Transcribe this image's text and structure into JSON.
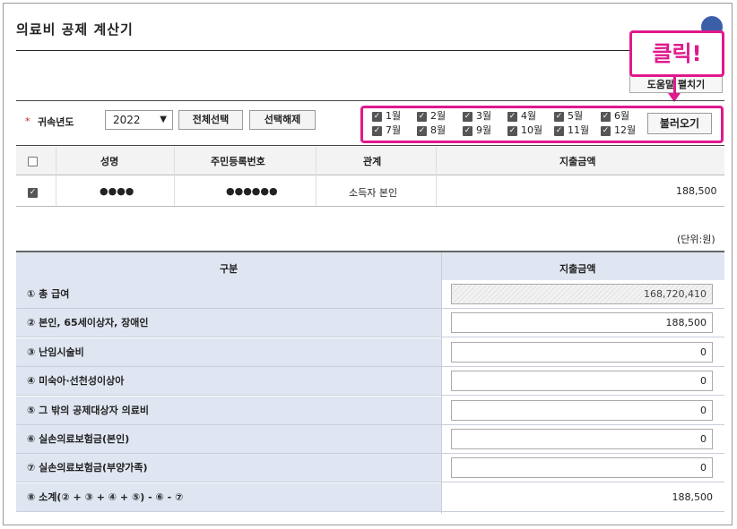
{
  "page_title": "의료비 공제 계산기",
  "callout": "클릭!",
  "help_button": "도움말 펼치기",
  "filters": {
    "year_label": "귀속년도",
    "year_value": "2022",
    "select_all": "전체선택",
    "deselect_all": "선택해제",
    "months": [
      "1월",
      "2월",
      "3월",
      "4월",
      "5월",
      "6월",
      "7월",
      "8월",
      "9월",
      "10월",
      "11월",
      "12월"
    ],
    "load_button": "불러오기"
  },
  "person_table": {
    "headers": [
      "성명",
      "주민등록번호",
      "관계",
      "지출금액"
    ],
    "rows": [
      {
        "checked": true,
        "name": "●●●●",
        "id": "●●●●●●",
        "relation": "소득자 본인",
        "amount": "188,500"
      }
    ]
  },
  "unit_label": "(단위:원)",
  "calc_table": {
    "headers": [
      "구분",
      "지출금액"
    ],
    "rows": [
      {
        "label": "① 총 급여",
        "value": "168,720,410",
        "readonly": true
      },
      {
        "label": "② 본인, 65세이상자, 장애인",
        "value": "188,500"
      },
      {
        "label": "③ 난임시술비",
        "value": "0"
      },
      {
        "label": "④ 미숙아·선천성이상아",
        "value": "0"
      },
      {
        "label": "⑤ 그 밖의 공제대상자 의료비",
        "value": "0"
      },
      {
        "label": "⑥ 실손의료보험금(본인)",
        "value": "0"
      },
      {
        "label": "⑦ 실손의료보험금(부양가족)",
        "value": "0"
      },
      {
        "label": "⑧ 소계(② + ③ + ④ + ⑤) - ⑥ - ⑦",
        "value": "188,500",
        "plain": true
      }
    ]
  },
  "colors": {
    "highlight": "#e0198c",
    "header_bg": "#dfe6f1"
  }
}
